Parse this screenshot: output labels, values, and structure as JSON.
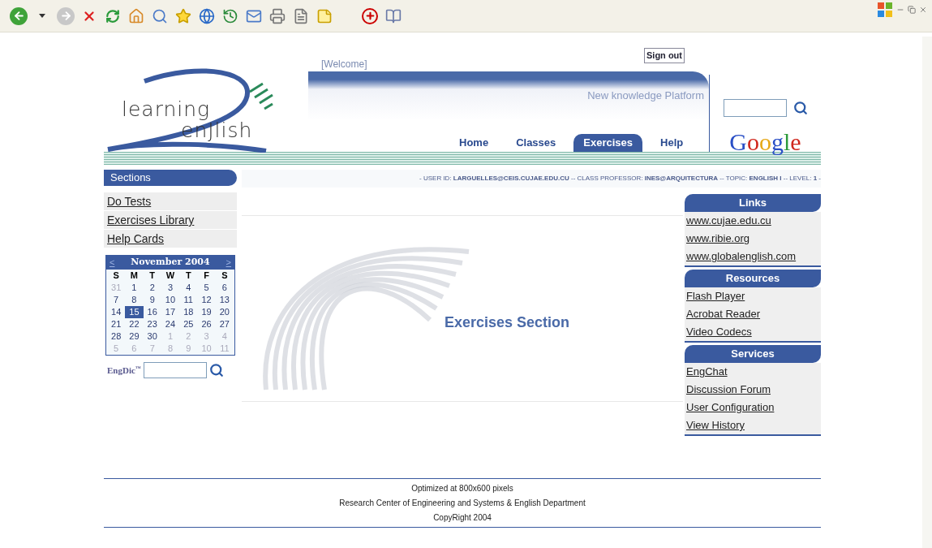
{
  "header": {
    "welcome": "[Welcome]",
    "sign_out": "Sign out",
    "tagline": "New knowledge Platform",
    "logo_top": "learning",
    "logo_bottom": "enJlish",
    "google": "Google"
  },
  "nav": [
    {
      "label": "Home",
      "selected": false
    },
    {
      "label": "Classes",
      "selected": false
    },
    {
      "label": "Exercises",
      "selected": true
    },
    {
      "label": "Help",
      "selected": false
    }
  ],
  "info_line": "- USER ID: **LARGUELLES@CEIS.CUJAE.EDU.CU** -- CLASS PROFESSOR: **INES@ARQUITECTURA** -- TOPIC: **ENGLISH I** -- LEVEL: **1** -",
  "sections": {
    "title": "Sections",
    "items": [
      "Do Tests",
      "Exercises Library",
      "Help Cards"
    ]
  },
  "calendar": {
    "prev": "<",
    "month": "November 2004",
    "next": ">",
    "weekdays": [
      "S",
      "M",
      "T",
      "W",
      "T",
      "F",
      "S"
    ],
    "weeks": [
      [
        {
          "d": "31",
          "other": true,
          "selected": false
        },
        {
          "d": "1",
          "other": false,
          "selected": false
        },
        {
          "d": "2",
          "other": false,
          "selected": false
        },
        {
          "d": "3",
          "other": false,
          "selected": false
        },
        {
          "d": "4",
          "other": false,
          "selected": false
        },
        {
          "d": "5",
          "other": false,
          "selected": false
        },
        {
          "d": "6",
          "other": false,
          "selected": false
        }
      ],
      [
        {
          "d": "7",
          "other": false,
          "selected": false
        },
        {
          "d": "8",
          "other": false,
          "selected": false
        },
        {
          "d": "9",
          "other": false,
          "selected": false
        },
        {
          "d": "10",
          "other": false,
          "selected": false
        },
        {
          "d": "11",
          "other": false,
          "selected": false
        },
        {
          "d": "12",
          "other": false,
          "selected": false
        },
        {
          "d": "13",
          "other": false,
          "selected": false
        }
      ],
      [
        {
          "d": "14",
          "other": false,
          "selected": false
        },
        {
          "d": "15",
          "other": false,
          "selected": true
        },
        {
          "d": "16",
          "other": false,
          "selected": false
        },
        {
          "d": "17",
          "other": false,
          "selected": false
        },
        {
          "d": "18",
          "other": false,
          "selected": false
        },
        {
          "d": "19",
          "other": false,
          "selected": false
        },
        {
          "d": "20",
          "other": false,
          "selected": false
        }
      ],
      [
        {
          "d": "21",
          "other": false,
          "selected": false
        },
        {
          "d": "22",
          "other": false,
          "selected": false
        },
        {
          "d": "23",
          "other": false,
          "selected": false
        },
        {
          "d": "24",
          "other": false,
          "selected": false
        },
        {
          "d": "25",
          "other": false,
          "selected": false
        },
        {
          "d": "26",
          "other": false,
          "selected": false
        },
        {
          "d": "27",
          "other": false,
          "selected": false
        }
      ],
      [
        {
          "d": "28",
          "other": false,
          "selected": false
        },
        {
          "d": "29",
          "other": false,
          "selected": false
        },
        {
          "d": "30",
          "other": false,
          "selected": false
        },
        {
          "d": "1",
          "other": true,
          "selected": false
        },
        {
          "d": "2",
          "other": true,
          "selected": false
        },
        {
          "d": "3",
          "other": true,
          "selected": false
        },
        {
          "d": "4",
          "other": true,
          "selected": false
        }
      ],
      [
        {
          "d": "5",
          "other": true,
          "selected": false
        },
        {
          "d": "6",
          "other": true,
          "selected": false
        },
        {
          "d": "7",
          "other": true,
          "selected": false
        },
        {
          "d": "8",
          "other": true,
          "selected": false
        },
        {
          "d": "9",
          "other": true,
          "selected": false
        },
        {
          "d": "10",
          "other": true,
          "selected": false
        },
        {
          "d": "11",
          "other": true,
          "selected": false
        }
      ]
    ]
  },
  "engdic": {
    "label": "EngDic",
    "mark": "™"
  },
  "main": {
    "title": "Exercises Section"
  },
  "panels": [
    {
      "title": "Links",
      "items": [
        "www.cujae.edu.cu",
        "www.ribie.org",
        "www.globalenglish.com"
      ]
    },
    {
      "title": "Resources",
      "items": [
        "Flash Player",
        "Acrobat Reader",
        "Video Codecs"
      ]
    },
    {
      "title": "Services",
      "items": [
        "EngChat",
        "Discussion Forum",
        "User Configuration",
        "View History"
      ]
    }
  ],
  "footer": [
    "Optimized at 800x600 pixels",
    "Research Center of Engineering and Systems & English Department",
    "CopyRight 2004"
  ]
}
